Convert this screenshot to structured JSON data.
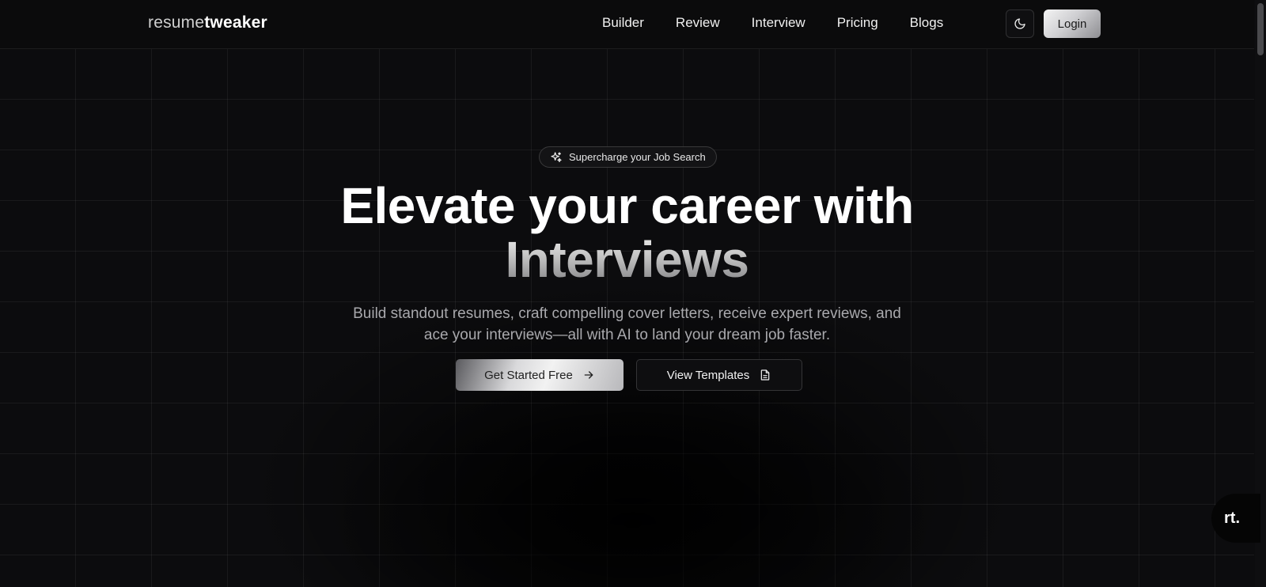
{
  "brand": {
    "logo_light": "resume",
    "logo_bold": "tweaker"
  },
  "nav": {
    "items": [
      {
        "label": "Builder"
      },
      {
        "label": "Review"
      },
      {
        "label": "Interview"
      },
      {
        "label": "Pricing"
      },
      {
        "label": "Blogs"
      }
    ],
    "theme_icon": "moon-icon",
    "login_label": "Login"
  },
  "hero": {
    "badge_icon": "sparkles-icon",
    "badge_text": "Supercharge your Job Search",
    "headline_line1": "Elevate your career with",
    "headline_line2": "Interviews",
    "subtitle": "Build standout resumes, craft compelling cover letters, receive expert reviews, and ace your interviews—all with AI to land your dream job faster.",
    "primary_cta": "Get Started Free",
    "primary_cta_icon": "arrow-right-icon",
    "secondary_cta": "View Templates",
    "secondary_cta_icon": "document-icon"
  },
  "widget": {
    "label": "rt."
  },
  "colors": {
    "background": "#0c0c0e",
    "text": "#ffffff",
    "muted_text": "#a9a9ad",
    "button_silver": "#d9d9db"
  }
}
